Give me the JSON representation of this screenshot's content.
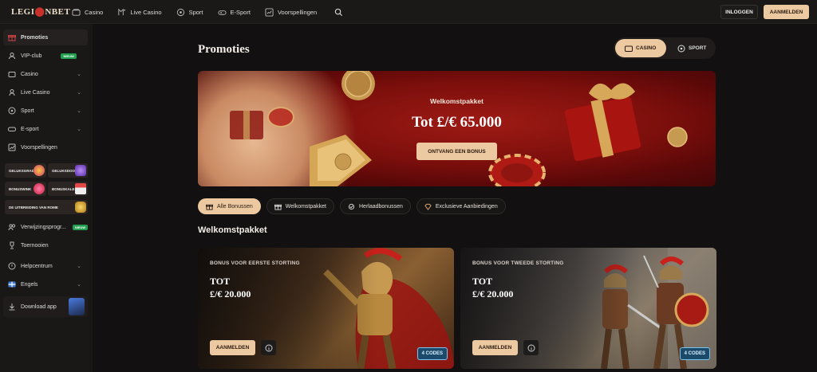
{
  "topbar": {
    "logo_left": "LEGI",
    "logo_right": "NBET",
    "nav": [
      {
        "label": "Casino",
        "icon": "casino-icon"
      },
      {
        "label": "Live Casino",
        "icon": "live-casino-icon"
      },
      {
        "label": "Sport",
        "icon": "soccer-ball-icon"
      },
      {
        "label": "E-Sport",
        "icon": "gamepad-icon"
      },
      {
        "label": "Voorspellingen",
        "icon": "chart-icon"
      }
    ],
    "login_label": "INLOGGEN",
    "register_label": "AANMELDEN"
  },
  "sidebar": {
    "items": [
      {
        "label": "Promoties",
        "icon": "gift-icon"
      },
      {
        "label": "VIP-club",
        "icon": "vip-icon",
        "badge": "NIEUW"
      },
      {
        "label": "Casino",
        "icon": "casino-icon"
      },
      {
        "label": "Live Casino",
        "icon": "live-casino-icon"
      },
      {
        "label": "Sport",
        "icon": "soccer-ball-icon"
      },
      {
        "label": "E-sport",
        "icon": "gamepad-icon"
      },
      {
        "label": "Voorspellingen",
        "icon": "chart-icon"
      },
      {
        "label": "Verwijzingsprogr...",
        "icon": "referral-icon",
        "badge": "NIEUW"
      },
      {
        "label": "Toernooien",
        "icon": "trophy-icon"
      },
      {
        "label": "Helpcentrum",
        "icon": "help-icon"
      },
      {
        "label": "Engels",
        "icon": "flag-icon"
      },
      {
        "label": "Download app",
        "icon": "download-icon"
      }
    ],
    "tiles": [
      "GELUKSGRAD",
      "GELUKSDOOS",
      "BONUSWINK",
      "BONUSKALE",
      "DE UITBREIDING VAN ROME"
    ]
  },
  "main": {
    "title": "Promoties",
    "toggle": {
      "casino": "CASINO",
      "sport": "SPORT"
    },
    "banner": {
      "subtitle": "Welkomstpakket",
      "amount": "Tot £/€ 65.000",
      "cta": "ONTVANG EEN BONUS"
    },
    "chips": [
      {
        "label": "Alle Bonussen",
        "icon": "gift-icon",
        "active": true
      },
      {
        "label": "Welkomstpakket",
        "icon": "gift-box-icon",
        "active": false
      },
      {
        "label": "Herlaadbonussen",
        "icon": "reload-icon",
        "active": false
      },
      {
        "label": "Exclusieve Aanbiedingen",
        "icon": "diamond-icon",
        "active": false
      }
    ],
    "section_title": "Welkomstpakket",
    "cards": [
      {
        "label": "BONUS VOOR EERSTE STORTING",
        "tot": "TOT",
        "amount": "£/€ 20.000",
        "button": "AANMELDEN",
        "codes": "4 CODES"
      },
      {
        "label": "BONUS VOOR TWEEDE STORTING",
        "tot": "TOT",
        "amount": "£/€ 20.000",
        "button": "AANMELDEN",
        "codes": "4 CODES"
      }
    ]
  },
  "colors": {
    "accent": "#ecc9a0",
    "background": "#121010",
    "sidebar": "#1a1817",
    "badge_green": "#22a050"
  }
}
